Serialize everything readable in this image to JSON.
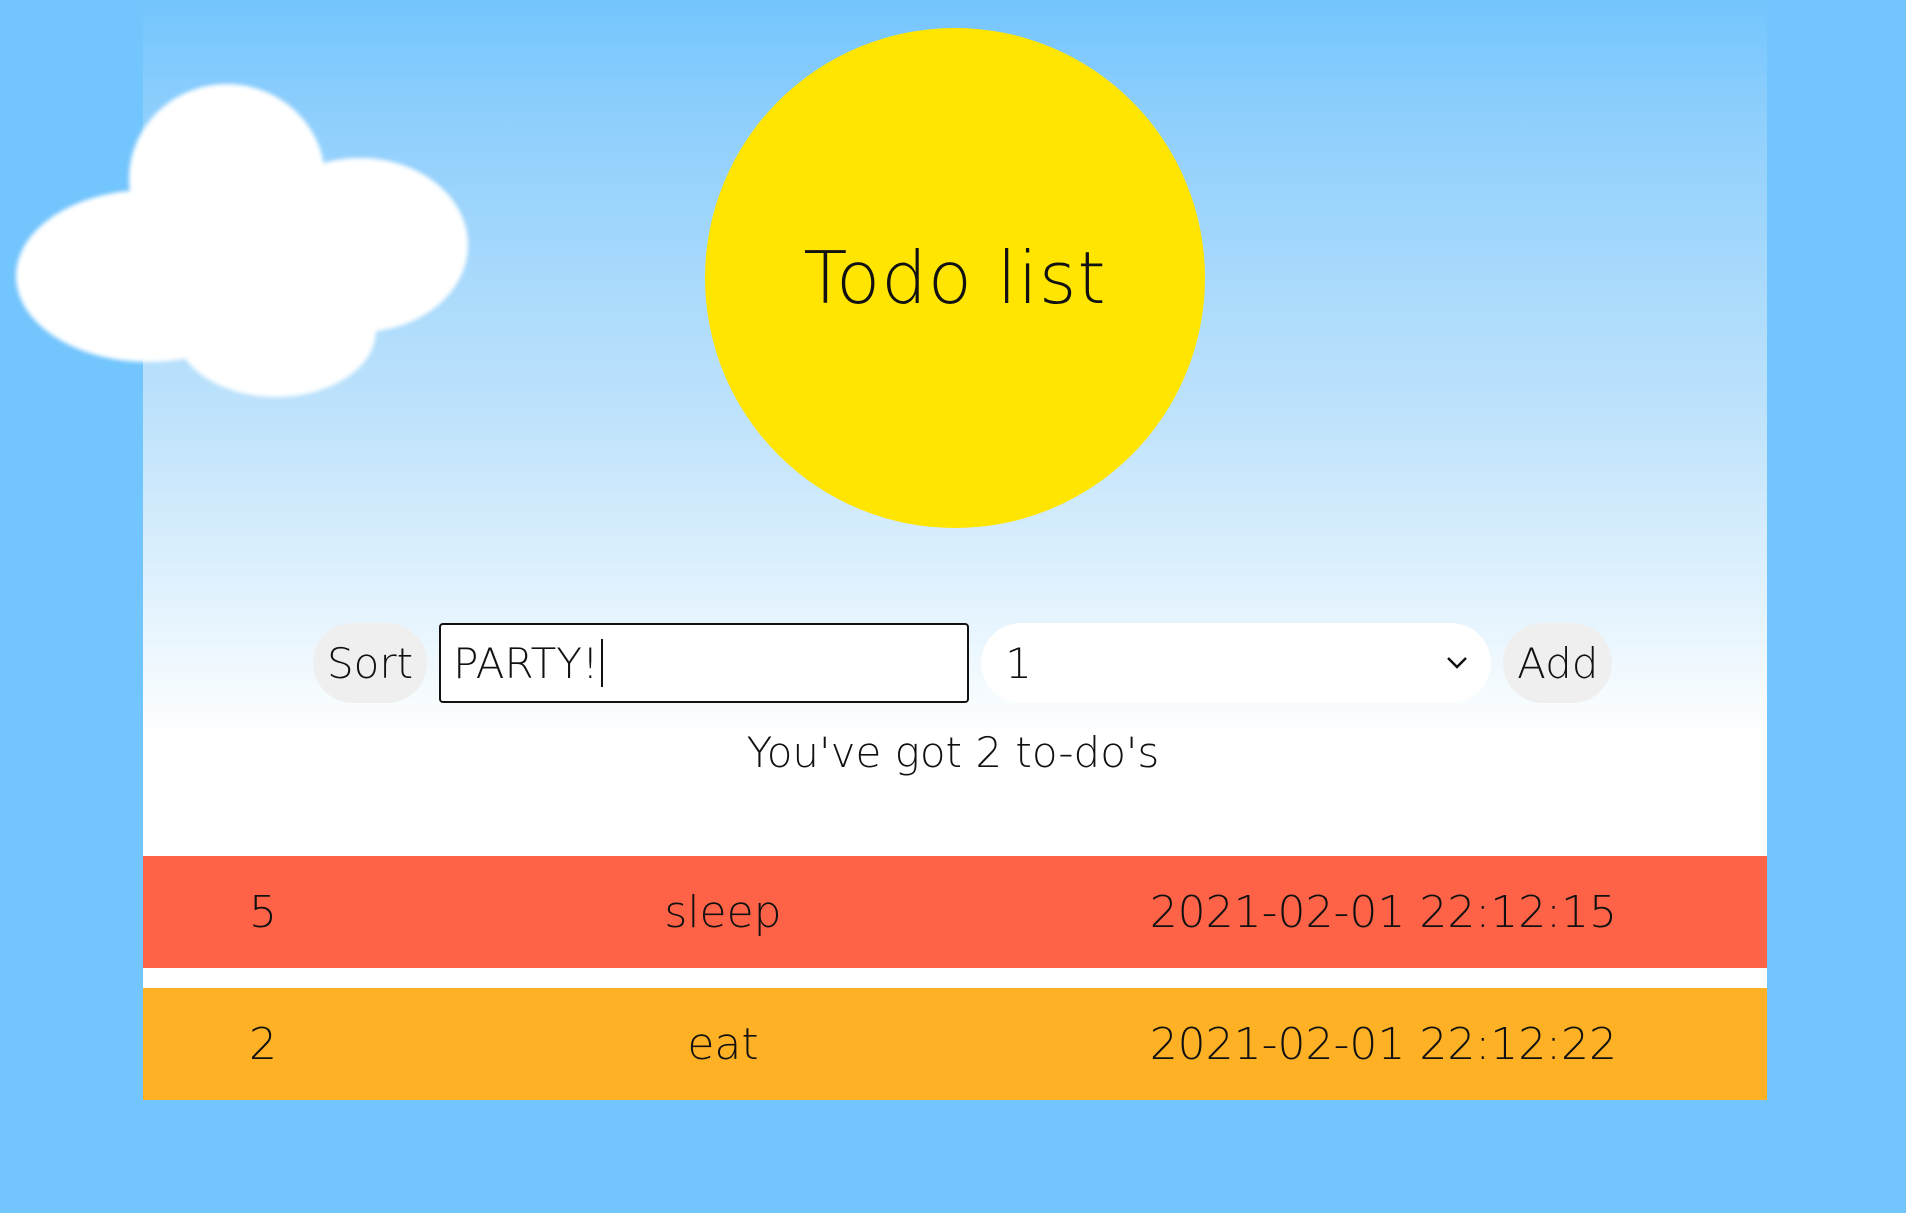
{
  "app": {
    "title": "Todo list"
  },
  "controls": {
    "sort_label": "Sort",
    "input_value": "PARTY!",
    "select_value": "1",
    "add_label": "Add"
  },
  "summary": {
    "count_text": "You've got 2 to-do's"
  },
  "todos": [
    {
      "priority": "5",
      "text": "sleep",
      "timestamp": "2021-02-01 22:12:15",
      "color": "#ff6347"
    },
    {
      "priority": "2",
      "text": "eat",
      "timestamp": "2021-02-01 22:12:22",
      "color": "#ffb125"
    }
  ],
  "colors": {
    "background": "#73c5fd",
    "sun": "#ffe500"
  },
  "icons": {
    "cloud": "cloud-icon",
    "sun": "sun-icon",
    "select_arrow": "chevron-down-icon"
  }
}
